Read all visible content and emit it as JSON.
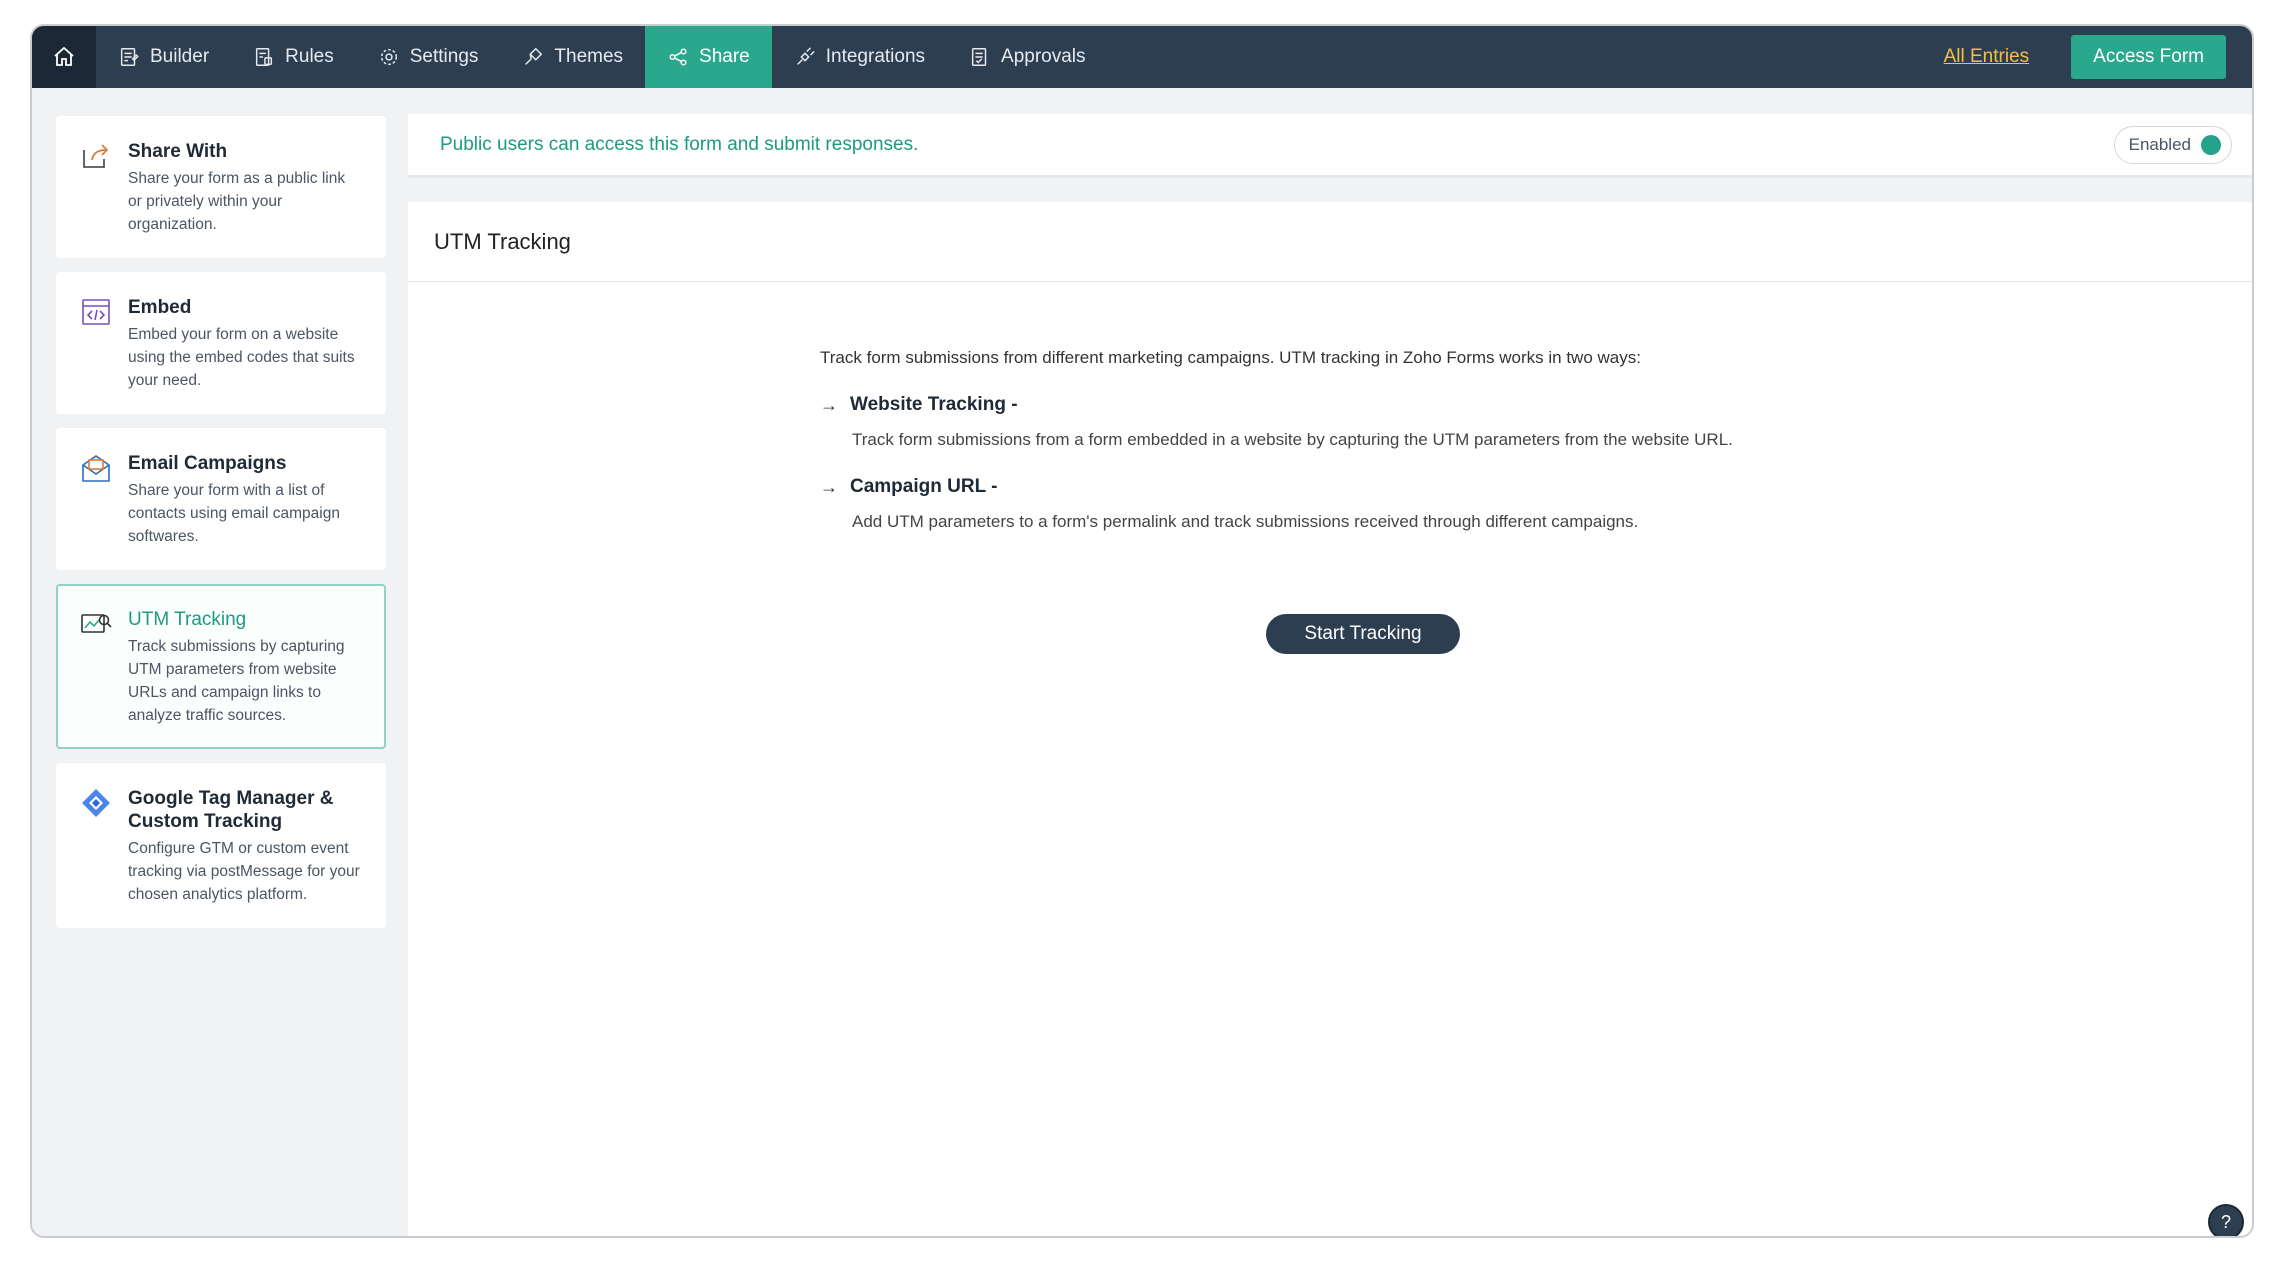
{
  "nav": {
    "items": [
      {
        "label": "Builder",
        "icon": "builder-icon"
      },
      {
        "label": "Rules",
        "icon": "rules-icon"
      },
      {
        "label": "Settings",
        "icon": "gear-icon"
      },
      {
        "label": "Themes",
        "icon": "themes-icon"
      },
      {
        "label": "Share",
        "icon": "share-icon"
      },
      {
        "label": "Integrations",
        "icon": "integrations-icon"
      },
      {
        "label": "Approvals",
        "icon": "approvals-icon"
      }
    ],
    "active": "Share",
    "all_entries": "All Entries",
    "access_form": "Access Form"
  },
  "sidebar": {
    "cards": [
      {
        "title": "Share With",
        "desc": "Share your form as a public link or privately within your organization."
      },
      {
        "title": "Embed",
        "desc": "Embed your form on a website using the embed codes that suits your need."
      },
      {
        "title": "Email Campaigns",
        "desc": "Share your form with a list of contacts using email campaign softwares."
      },
      {
        "title": "UTM Tracking",
        "desc": "Track submissions by capturing UTM parameters from website URLs and campaign links to analyze traffic sources."
      },
      {
        "title": "Google Tag Manager & Custom Tracking",
        "desc": "Configure GTM or custom event tracking via postMessage for your chosen analytics platform."
      }
    ]
  },
  "banner": {
    "text": "Public users can access this form and submit responses.",
    "toggle_label": "Enabled"
  },
  "panel": {
    "title": "UTM Tracking",
    "intro": "Track form submissions from different marketing campaigns. UTM tracking in Zoho Forms works in two ways:",
    "bullets": [
      {
        "title": "Website Tracking -",
        "desc": "Track form submissions from a form embedded in a website by capturing the UTM parameters from the website URL."
      },
      {
        "title": "Campaign URL -",
        "desc": "Add UTM parameters to a form's permalink and track submissions received through different campaigns."
      }
    ],
    "start_button": "Start Tracking"
  },
  "help": {
    "label": "?"
  },
  "colors": {
    "accent": "#2aa88d",
    "nav_bg": "#2e3e51",
    "link": "#f0c04a"
  }
}
